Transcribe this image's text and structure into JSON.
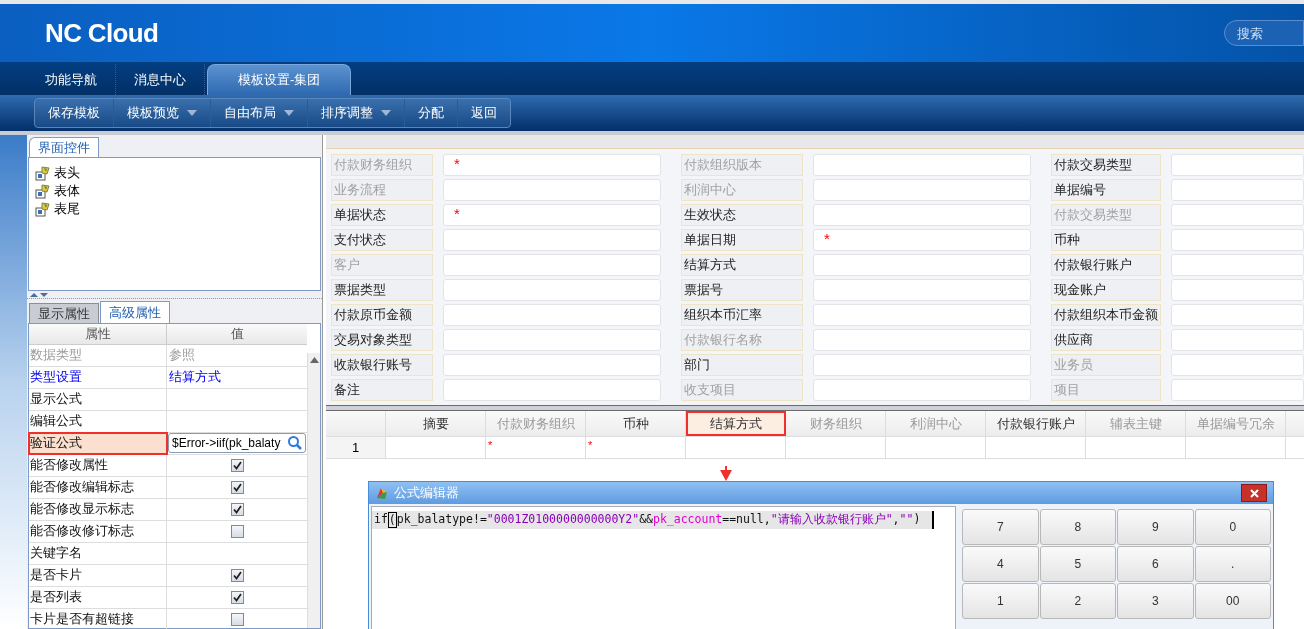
{
  "header": {
    "logo": "NC Cloud",
    "search": {
      "placeholder": "搜索"
    }
  },
  "tabs": [
    {
      "label": "功能导航",
      "selected": false
    },
    {
      "label": "消息中心",
      "selected": false
    },
    {
      "label": "模板设置-集团",
      "selected": true
    }
  ],
  "toolbar": [
    {
      "label": "保存模板",
      "dropdown": false
    },
    {
      "label": "模板预览",
      "dropdown": true
    },
    {
      "label": "自由布局",
      "dropdown": true
    },
    {
      "label": "排序调整",
      "dropdown": true
    },
    {
      "label": "分配",
      "dropdown": false
    },
    {
      "label": "返回",
      "dropdown": false
    }
  ],
  "left_panel": {
    "tab": "界面控件",
    "tree": [
      {
        "label": "表头"
      },
      {
        "label": "表体"
      },
      {
        "label": "表尾"
      }
    ],
    "property_tabs": [
      {
        "label": "显示属性",
        "selected": false
      },
      {
        "label": "高级属性",
        "selected": true
      }
    ],
    "property_table": {
      "columns": [
        "属性",
        "值"
      ],
      "rows": [
        {
          "name": "数据类型",
          "disabled": true,
          "link": false,
          "kind": "text",
          "value": "参照",
          "selected": false,
          "annotated": false
        },
        {
          "name": "类型设置",
          "disabled": false,
          "link": true,
          "kind": "text",
          "value": "结算方式",
          "selected": false,
          "annotated": false
        },
        {
          "name": "显示公式",
          "disabled": false,
          "link": false,
          "kind": "text",
          "selected": false,
          "annotated": false
        },
        {
          "name": "编辑公式",
          "disabled": false,
          "link": false,
          "kind": "text",
          "selected": false,
          "annotated": false
        },
        {
          "name": "验证公式",
          "disabled": false,
          "link": false,
          "kind": "field",
          "value": "$Error->iif(pk_balaty",
          "selected": true,
          "annotated": true
        },
        {
          "name": "能否修改属性",
          "disabled": false,
          "link": false,
          "kind": "checkbox",
          "checked": true,
          "selected": false,
          "annotated": false
        },
        {
          "name": "能否修改编辑标志",
          "disabled": false,
          "link": false,
          "kind": "checkbox",
          "checked": true,
          "selected": false,
          "annotated": false
        },
        {
          "name": "能否修改显示标志",
          "disabled": false,
          "link": false,
          "kind": "checkbox",
          "checked": true,
          "selected": false,
          "annotated": false
        },
        {
          "name": "能否修改修订标志",
          "disabled": false,
          "link": false,
          "kind": "checkbox",
          "checked": false,
          "selected": false,
          "annotated": false
        },
        {
          "name": "关键字名",
          "disabled": false,
          "link": false,
          "kind": "text",
          "selected": false,
          "annotated": false
        },
        {
          "name": "是否卡片",
          "disabled": false,
          "link": false,
          "kind": "checkbox",
          "checked": true,
          "selected": false,
          "annotated": false
        },
        {
          "name": "是否列表",
          "disabled": false,
          "link": false,
          "kind": "checkbox",
          "checked": true,
          "selected": false,
          "annotated": false
        },
        {
          "name": "卡片是否有超链接",
          "disabled": false,
          "link": false,
          "kind": "checkbox",
          "checked": false,
          "selected": false,
          "annotated": false
        }
      ]
    }
  },
  "form": {
    "fields": [
      {
        "label": "付款财务组织",
        "disabled": true,
        "required_mark": "*"
      },
      {
        "label": "付款组织版本",
        "disabled": true
      },
      {
        "label": "付款交易类型",
        "disabled": false
      },
      {
        "label": "业务流程",
        "disabled": true
      },
      {
        "label": "利润中心",
        "disabled": true
      },
      {
        "label": "单据编号",
        "disabled": false
      },
      {
        "label": "单据状态",
        "disabled": false,
        "required_mark": "*"
      },
      {
        "label": "生效状态",
        "disabled": false
      },
      {
        "label": "付款交易类型",
        "disabled": true
      },
      {
        "label": "支付状态",
        "disabled": false
      },
      {
        "label": "单据日期",
        "disabled": false,
        "required_mark": "*"
      },
      {
        "label": "币种",
        "disabled": false
      },
      {
        "label": "客户",
        "disabled": true
      },
      {
        "label": "结算方式",
        "disabled": false
      },
      {
        "label": "付款银行账户",
        "disabled": false
      },
      {
        "label": "票据类型",
        "disabled": false
      },
      {
        "label": "票据号",
        "disabled": false
      },
      {
        "label": "现金账户",
        "disabled": false
      },
      {
        "label": "付款原币金额",
        "disabled": false
      },
      {
        "label": "组织本币汇率",
        "disabled": false
      },
      {
        "label": "付款组织本币金额",
        "disabled": false
      },
      {
        "label": "交易对象类型",
        "disabled": false
      },
      {
        "label": "付款银行名称",
        "disabled": true
      },
      {
        "label": "供应商",
        "disabled": false
      },
      {
        "label": "收款银行账号",
        "disabled": false
      },
      {
        "label": "部门",
        "disabled": false
      },
      {
        "label": "业务员",
        "disabled": true
      },
      {
        "label": "备注",
        "disabled": false
      },
      {
        "label": "收支项目",
        "disabled": true
      },
      {
        "label": "项目",
        "disabled": true
      }
    ]
  },
  "grid": {
    "columns": [
      {
        "label": "摘要",
        "disabled": false,
        "annotated": false
      },
      {
        "label": "付款财务组织",
        "disabled": true,
        "annotated": false
      },
      {
        "label": "币种",
        "disabled": false,
        "annotated": false
      },
      {
        "label": "结算方式",
        "disabled": false,
        "annotated": true
      },
      {
        "label": "财务组织",
        "disabled": true,
        "annotated": false
      },
      {
        "label": "利润中心",
        "disabled": true,
        "annotated": false
      },
      {
        "label": "付款银行账户",
        "disabled": false,
        "annotated": false
      },
      {
        "label": "辅表主键",
        "disabled": true,
        "annotated": false
      },
      {
        "label": "单据编号冗余",
        "disabled": true,
        "annotated": false
      }
    ],
    "rows": [
      {
        "number": "1",
        "cells": [
          {},
          {
            "mark": "*"
          },
          {
            "mark": "*"
          },
          {},
          {},
          {},
          {},
          {},
          {}
        ]
      }
    ]
  },
  "dialog": {
    "title": "公式编辑器",
    "code": [
      {
        "kind": "plain",
        "text": "if"
      },
      {
        "kind": "cursor",
        "text": "("
      },
      {
        "kind": "plain",
        "text": "pk_balatype!="
      },
      {
        "kind": "string",
        "text": "\"0001Z0100000000000Y2\""
      },
      {
        "kind": "plain",
        "text": "&&"
      },
      {
        "kind": "field",
        "text": "pk_account"
      },
      {
        "kind": "plain",
        "text": "==null,"
      },
      {
        "kind": "string",
        "text": "\"请输入收款银行账户\""
      },
      {
        "kind": "plain",
        "text": ","
      },
      {
        "kind": "string",
        "text": "\"\""
      },
      {
        "kind": "plain",
        "text": ")"
      }
    ],
    "keypad": [
      "7",
      "8",
      "9",
      "0",
      "4",
      "5",
      "6",
      ".",
      "1",
      "2",
      "3",
      "00"
    ]
  }
}
